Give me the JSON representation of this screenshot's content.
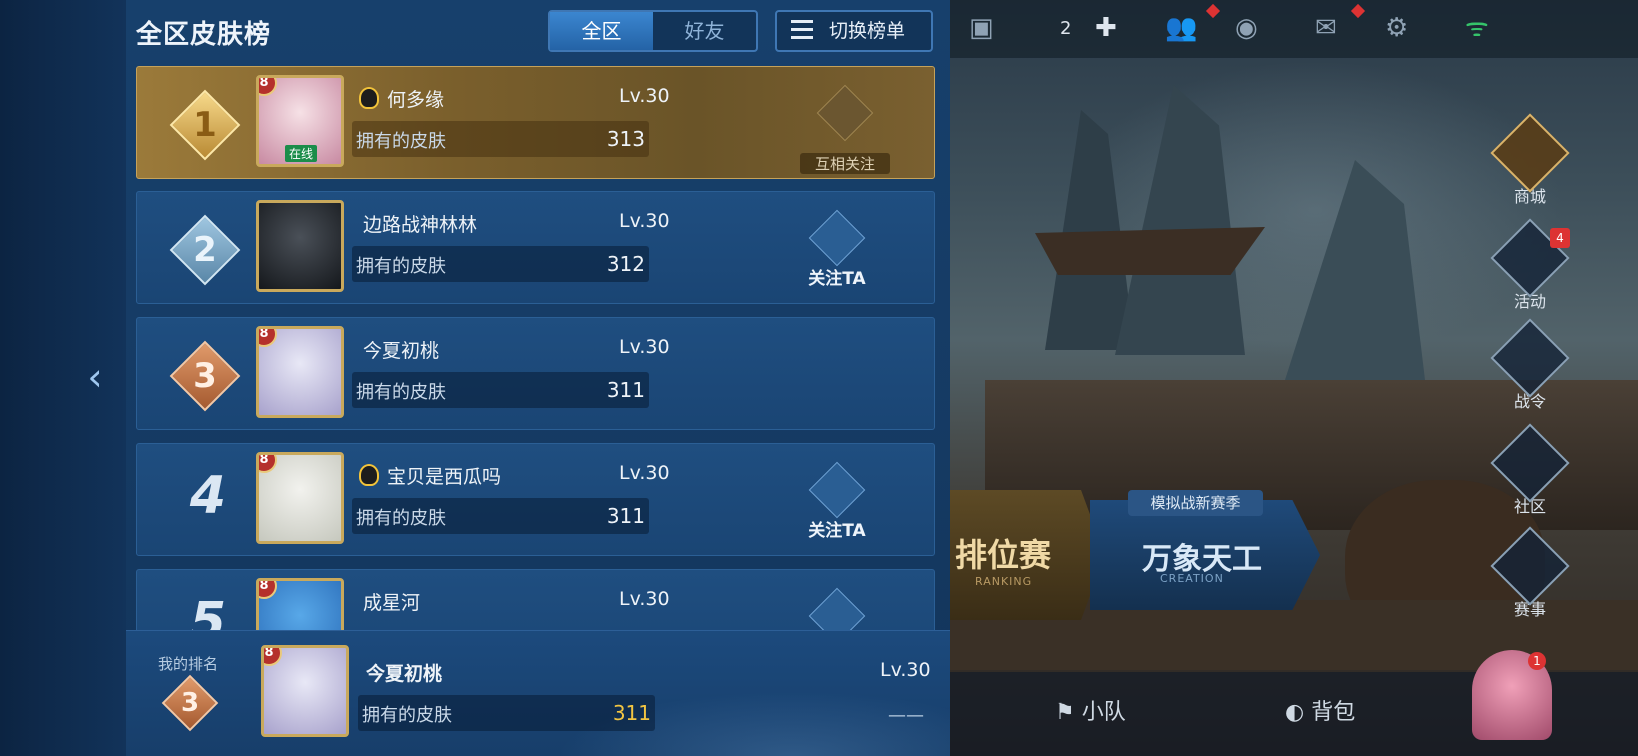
{
  "panel": {
    "title": "全区皮肤榜",
    "tabs": [
      {
        "label": "全区",
        "active": true
      },
      {
        "label": "好友",
        "active": false
      }
    ],
    "switch_label": "切换榜单"
  },
  "rows": [
    {
      "rank": "1",
      "name": "何多缘",
      "level": "Lv.30",
      "skin_label": "拥有的皮肤",
      "skins": "313",
      "avatar_level": "8",
      "online": "在线",
      "action": "互相关注",
      "qq": true
    },
    {
      "rank": "2",
      "name": "边路战神林林",
      "level": "Lv.30",
      "skin_label": "拥有的皮肤",
      "skins": "312",
      "avatar_level": "",
      "action": "关注TA",
      "qq": false
    },
    {
      "rank": "3",
      "name": "今夏初桃",
      "level": "Lv.30",
      "skin_label": "拥有的皮肤",
      "skins": "311",
      "avatar_level": "8",
      "action": "",
      "qq": false
    },
    {
      "rank": "4",
      "name": "宝贝是西瓜吗",
      "level": "Lv.30",
      "skin_label": "拥有的皮肤",
      "skins": "311",
      "avatar_level": "8",
      "action": "关注TA",
      "qq": true
    },
    {
      "rank": "5",
      "name": "成星河",
      "level": "Lv.30",
      "avatar_level": "8"
    }
  ],
  "my_rank": {
    "label": "我的排名",
    "rank": "3",
    "avatar_level": "8",
    "name": "今夏初桃",
    "level": "Lv.30",
    "skin_label": "拥有的皮肤",
    "skins": "311",
    "extra": "——"
  },
  "top_bar": {
    "count": "2"
  },
  "right_menu": [
    "商城",
    "活动",
    "战令",
    "社区",
    "赛事"
  ],
  "right_menu_badge": "4",
  "game_modes": {
    "ranking": "排位赛",
    "ranking_en": "RANKING",
    "mode_tag": "模拟战新赛季",
    "creation": "万象天工",
    "creation_en": "CREATION"
  },
  "bottom_bar": {
    "team": "小队",
    "bag": "背包",
    "avatar_badge": "1"
  },
  "colors": {
    "panel": "#17406c",
    "gold": "#c9a95c",
    "accent": "#3b86d0"
  }
}
